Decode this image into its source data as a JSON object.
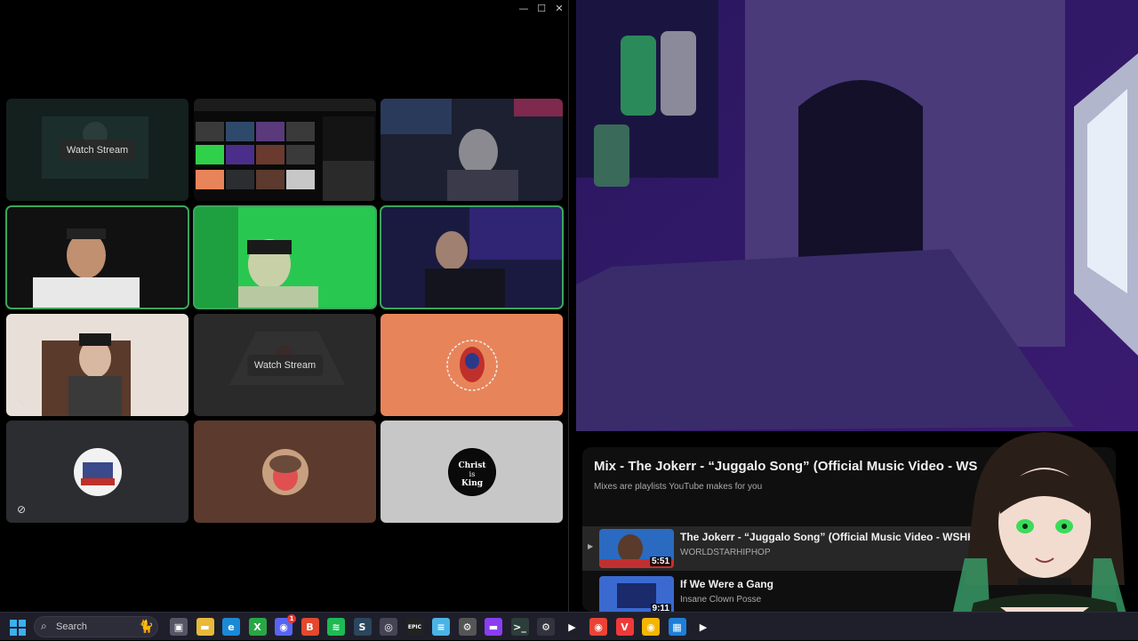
{
  "call_window": {
    "controls": {
      "minimize": "—",
      "maximize": "☐",
      "close": "✕"
    },
    "tiles": [
      {
        "id": "t1",
        "type": "stream-preview",
        "watch_label": "Watch Stream"
      },
      {
        "id": "t2",
        "type": "screen-share"
      },
      {
        "id": "t3",
        "type": "camera"
      },
      {
        "id": "t4",
        "type": "camera",
        "speaking": true
      },
      {
        "id": "t5",
        "type": "camera",
        "speaking": true
      },
      {
        "id": "t6",
        "type": "camera",
        "speaking": true
      },
      {
        "id": "t7",
        "type": "camera",
        "muted": true
      },
      {
        "id": "t8",
        "type": "stream-preview",
        "watch_label": "Watch Stream"
      },
      {
        "id": "t9",
        "type": "avatar",
        "bg": "#e8845a"
      },
      {
        "id": "t10",
        "type": "avatar",
        "bg": "#2b2d31",
        "avatar_text": "DEMAGE",
        "muted": true
      },
      {
        "id": "t11",
        "type": "avatar",
        "bg": "#5c3a2e"
      },
      {
        "id": "t12",
        "type": "avatar",
        "bg": "#c7c7c7",
        "avatar_text": "Christ is King"
      }
    ]
  },
  "playlist": {
    "title": "Mix - The Jokerr - “Juggalo Song” (Official Music Video - WS",
    "subtitle": "Mixes are playlists YouTube makes for you",
    "close": "✕",
    "items": [
      {
        "title": "The Jokerr - “Juggalo Song” (Official Music Video - WSHH Heat",
        "channel": "WORLDSTARHIPHOP",
        "duration": "5:51",
        "playing": true
      },
      {
        "title": "If We Were a Gang",
        "channel": "Insane Clown Posse",
        "duration": "9:11",
        "playing": false
      }
    ]
  },
  "taskbar": {
    "search_placeholder": "Search",
    "icons": [
      {
        "name": "task-view-icon",
        "color": "#555566",
        "glyph": "▣"
      },
      {
        "name": "file-explorer-icon",
        "color": "#e8b93a",
        "glyph": "▬"
      },
      {
        "name": "edge-icon",
        "color": "#1b8ad6",
        "glyph": "e"
      },
      {
        "name": "xbox-icon",
        "color": "#28a745",
        "glyph": "X"
      },
      {
        "name": "discord-icon",
        "color": "#5865f2",
        "glyph": "◉",
        "badge": "1"
      },
      {
        "name": "brave-icon",
        "color": "#e2492d",
        "glyph": "B"
      },
      {
        "name": "spotify-icon",
        "color": "#1db954",
        "glyph": "≋"
      },
      {
        "name": "steam-icon",
        "color": "#2a475e",
        "glyph": "S"
      },
      {
        "name": "obs-icon",
        "color": "#444455",
        "glyph": "◎"
      },
      {
        "name": "epic-games-icon",
        "color": "#222222",
        "glyph": "EPIC"
      },
      {
        "name": "notepad-icon",
        "color": "#4ab4e6",
        "glyph": "≡"
      },
      {
        "name": "github-desktop-icon",
        "color": "#555555",
        "glyph": "⚙"
      },
      {
        "name": "purple-app-icon",
        "color": "#8a3ef0",
        "glyph": "▬"
      },
      {
        "name": "terminal-icon",
        "color": "#2c3e3a",
        "glyph": ">_"
      },
      {
        "name": "settings-icon",
        "color": "#333340",
        "glyph": "⚙"
      },
      {
        "name": "play-icon",
        "color": "#1f1f2b",
        "glyph": "▶"
      },
      {
        "name": "chrome-icon",
        "color": "#ea4335",
        "glyph": "◉"
      },
      {
        "name": "vivaldi-icon",
        "color": "#ef3939",
        "glyph": "V"
      },
      {
        "name": "chrome-alt-icon",
        "color": "#f4b400",
        "glyph": "◉"
      },
      {
        "name": "app-blue-icon",
        "color": "#1e7fd6",
        "glyph": "▦"
      },
      {
        "name": "play-alt-icon",
        "color": "#1f1f2b",
        "glyph": "▶"
      }
    ]
  }
}
